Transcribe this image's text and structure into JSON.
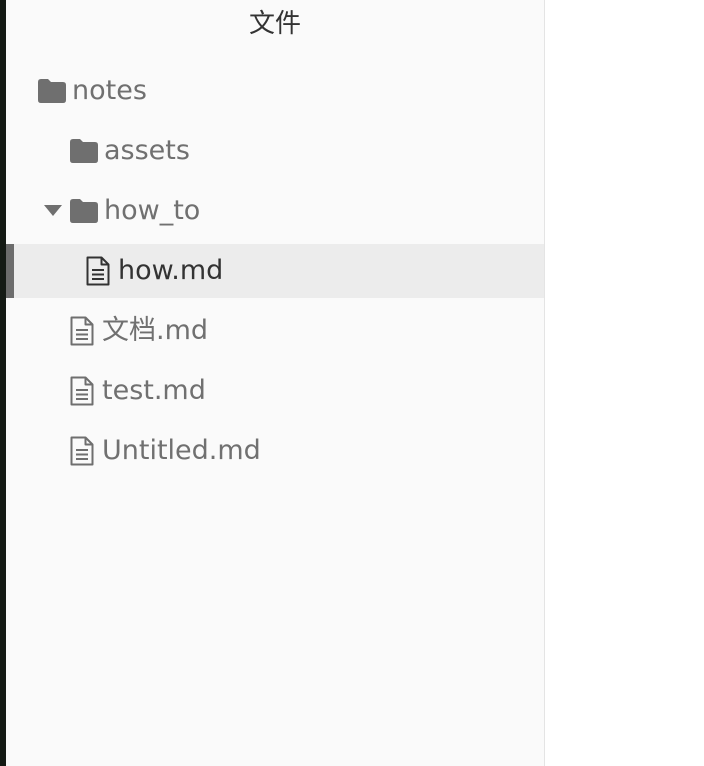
{
  "sidebar": {
    "title": "文件",
    "tree": [
      {
        "label": "notes",
        "type": "folder",
        "icon": "folder-icon"
      },
      {
        "label": "assets",
        "type": "folder",
        "icon": "folder-icon"
      },
      {
        "label": "how_to",
        "type": "folder",
        "icon": "folder-icon",
        "expanded": true,
        "toggle_icon": "caret-down-icon"
      },
      {
        "label": "how.md",
        "type": "file",
        "icon": "file-icon",
        "selected": true
      },
      {
        "label": "文档.md",
        "type": "file",
        "icon": "file-icon"
      },
      {
        "label": "test.md",
        "type": "file",
        "icon": "file-icon"
      },
      {
        "label": "Untitled.md",
        "type": "file",
        "icon": "file-icon"
      }
    ]
  },
  "colors": {
    "sidebar_background": "#fafafa",
    "selected_row": "#ececec",
    "selected_marker": "#6c6c6c",
    "icon": "#6f6f6f",
    "text": "#707070",
    "selected_text": "#333333"
  }
}
